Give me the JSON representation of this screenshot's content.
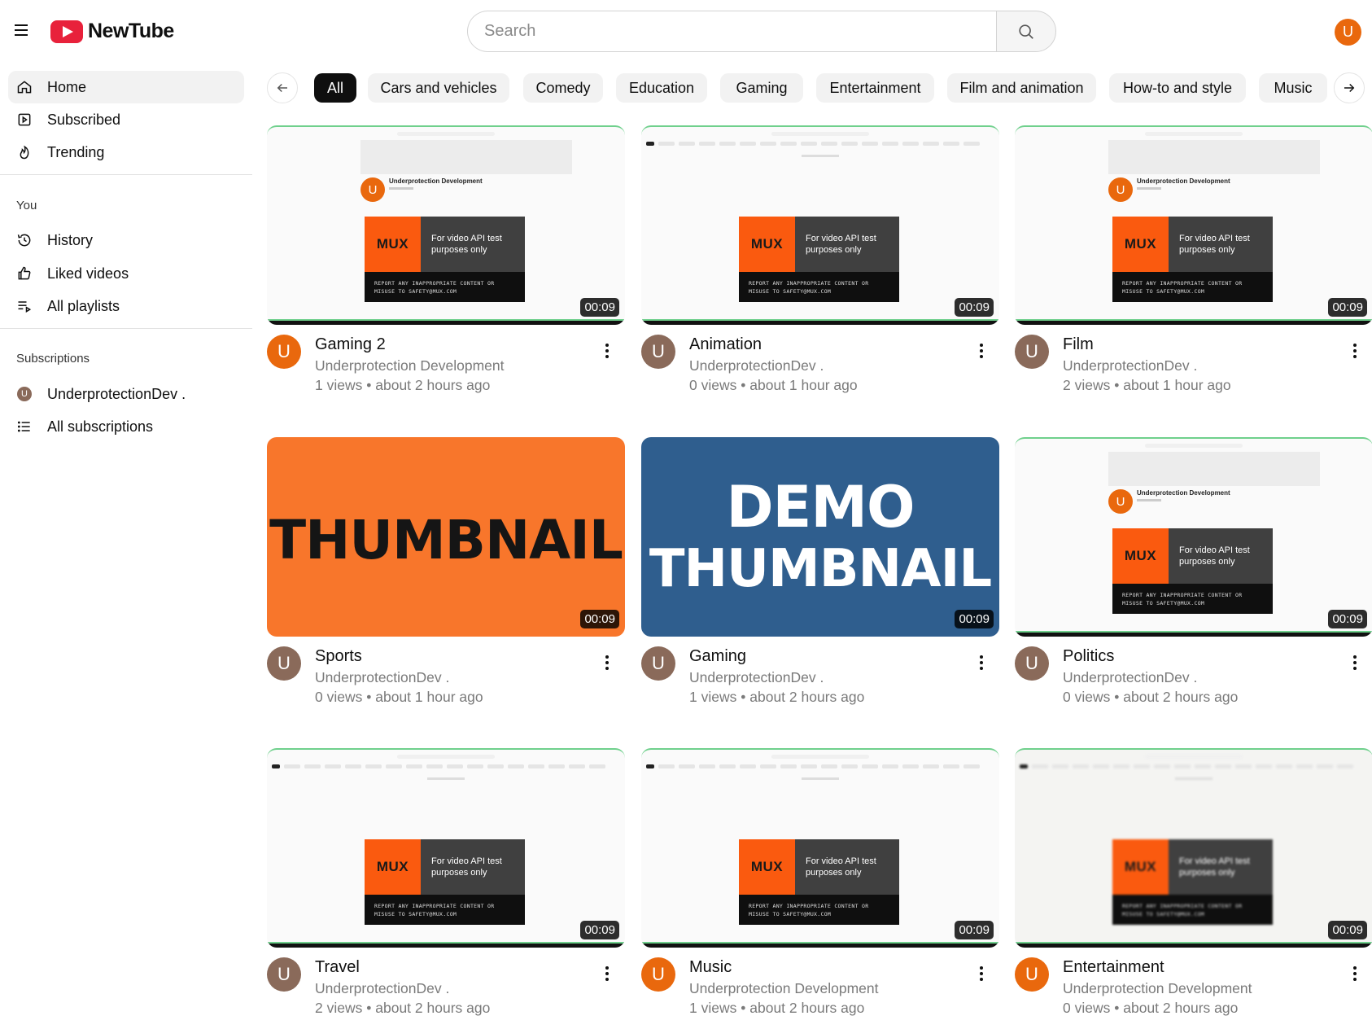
{
  "app": {
    "name": "NewTube"
  },
  "search": {
    "placeholder": "Search"
  },
  "user": {
    "initial": "U",
    "avatar_color": "#e9680d"
  },
  "sidebar": {
    "main": [
      {
        "label": "Home",
        "icon": "home-icon",
        "active": true
      },
      {
        "label": "Subscribed",
        "icon": "subscriptions-icon"
      },
      {
        "label": "Trending",
        "icon": "flame-icon"
      }
    ],
    "you_heading": "You",
    "you": [
      {
        "label": "History",
        "icon": "history-icon"
      },
      {
        "label": "Liked videos",
        "icon": "thumbs-up-icon"
      },
      {
        "label": "All playlists",
        "icon": "playlist-icon"
      }
    ],
    "subscriptions_heading": "Subscriptions",
    "subscriptions": [
      {
        "label": "UnderprotectionDev .",
        "avatar_initial": "U"
      },
      {
        "label": "All subscriptions",
        "icon": "list-icon"
      }
    ]
  },
  "chips": [
    "All",
    "Cars and vehicles",
    "Comedy",
    "Education",
    "Gaming",
    "Entertainment",
    "Film and animation",
    "How-to and style",
    "Music"
  ],
  "active_chip": "All",
  "mini_thumb": {
    "channel_name": "Underprotection Development",
    "mux_logo": "MUX",
    "mux_line1": "For video API test",
    "mux_line2": "purposes only",
    "mux_warning1": "REPORT ANY INAPPROPRIATE CONTENT OR",
    "mux_warning2": "MISUSE TO SAFETY@MUX.COM"
  },
  "videos": [
    {
      "title": "Gaming 2",
      "channel": "Underprotection Development",
      "views": "1 views",
      "age": "about 2 hours ago",
      "duration": "00:09",
      "thumb": "channel-page",
      "avatar_color": "#e9680d"
    },
    {
      "title": "Animation",
      "channel": "UnderprotectionDev .",
      "views": "0 views",
      "age": "about 1 hour ago",
      "duration": "00:09",
      "thumb": "home-page",
      "avatar_color": "#8a6a5a"
    },
    {
      "title": "Film",
      "channel": "UnderprotectionDev .",
      "views": "2 views",
      "age": "about 1 hour ago",
      "duration": "00:09",
      "thumb": "channel-page",
      "avatar_color": "#8a6a5a"
    },
    {
      "title": "Sports",
      "channel": "UnderprotectionDev .",
      "views": "0 views",
      "age": "about 1 hour ago",
      "duration": "00:09",
      "thumb": "orange",
      "thumb_text": "THUMBNAIL",
      "avatar_color": "#8a6a5a"
    },
    {
      "title": "Gaming",
      "channel": "UnderprotectionDev .",
      "views": "1 views",
      "age": "about 2 hours ago",
      "duration": "00:09",
      "thumb": "blue",
      "thumb_text_1": "DEMO",
      "thumb_text_2": "THUMBNAIL",
      "avatar_color": "#8a6a5a"
    },
    {
      "title": "Politics",
      "channel": "UnderprotectionDev .",
      "views": "0 views",
      "age": "about 2 hours ago",
      "duration": "00:09",
      "thumb": "channel-page",
      "avatar_color": "#8a6a5a"
    },
    {
      "title": "Travel",
      "channel": "UnderprotectionDev .",
      "views": "2 views",
      "age": "about 2 hours ago",
      "duration": "00:09",
      "thumb": "home-page",
      "avatar_color": "#8a6a5a"
    },
    {
      "title": "Music",
      "channel": "Underprotection Development",
      "views": "1 views",
      "age": "about 2 hours ago",
      "duration": "00:09",
      "thumb": "home-page",
      "avatar_color": "#e9680d"
    },
    {
      "title": "Entertainment",
      "channel": "Underprotection Development",
      "views": "0 views",
      "age": "about 2 hours ago",
      "duration": "00:09",
      "thumb": "home-page-blurred",
      "avatar_color": "#e9680d"
    }
  ],
  "separator": "•"
}
